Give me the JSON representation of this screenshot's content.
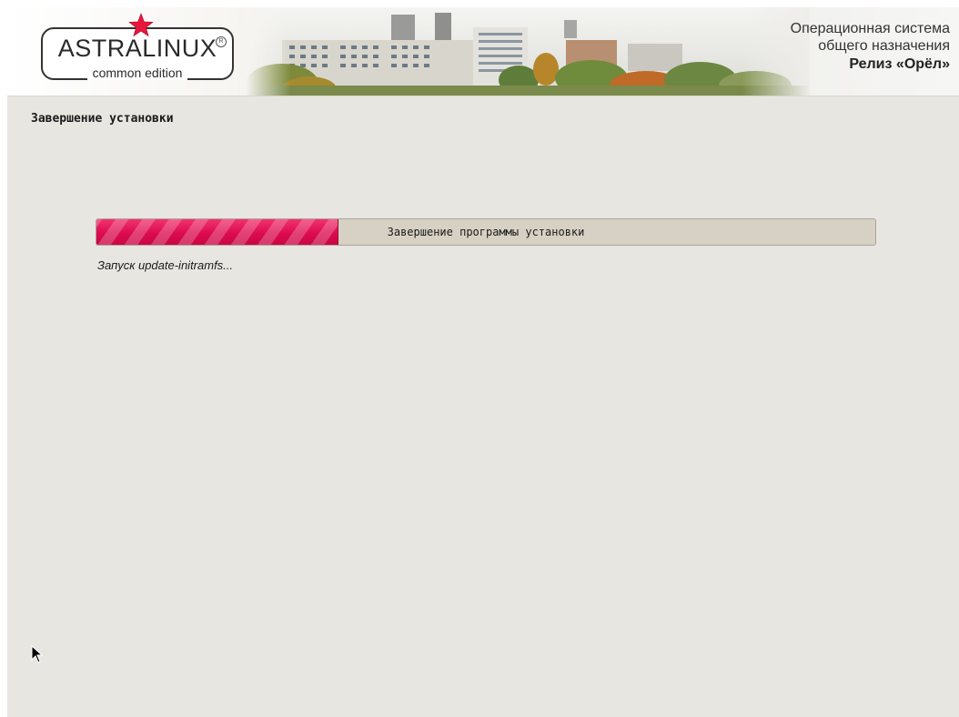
{
  "header": {
    "logo_title": "ASTRALINUX",
    "logo_subtitle": "common edition",
    "registered_mark": "R",
    "os_line1": "Операционная система",
    "os_line2": "общего назначения",
    "release": "Релиз «Орёл»",
    "brand_color": "#e8173c"
  },
  "step": {
    "title": "Завершение установки"
  },
  "progress": {
    "label": "Завершение программы установки",
    "fraction": 0.31,
    "fill_color": "#dc0b4f",
    "status": "Запуск update-initramfs..."
  },
  "pointer": {
    "icon": "arrow-cursor-icon"
  }
}
